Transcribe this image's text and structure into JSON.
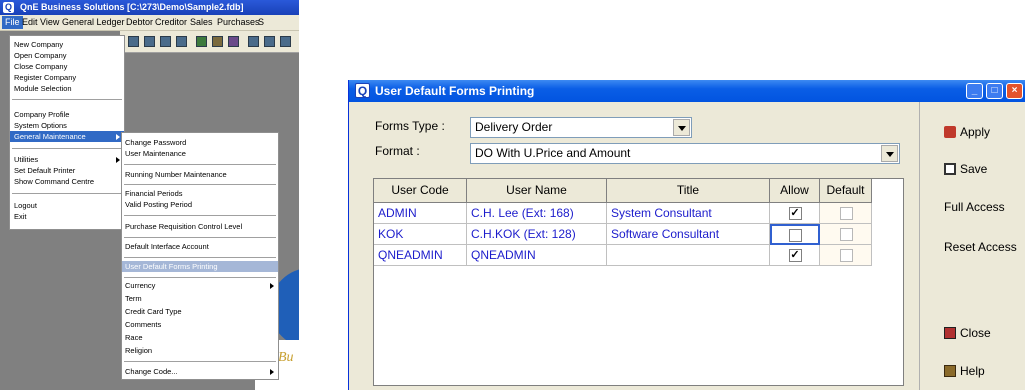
{
  "app": {
    "title": "QnE Business Solutions [C:\\273\\Demo\\Sample2.fdb]",
    "menubar": [
      "File",
      "Edit",
      "View",
      "General Ledger",
      "Debtor",
      "Creditor",
      "Sales",
      "Purchases",
      "S"
    ],
    "file_menu": [
      "New Company",
      "Open Company",
      "Close Company",
      "Register Company",
      "Module Selection",
      "Company Profile",
      "System Options",
      "General Maintenance",
      "Utilities",
      "Set Default Printer",
      "Show Command Centre",
      "Logout",
      "Exit"
    ],
    "submenu": [
      "Change Password",
      "User Maintenance",
      "Running Number Maintenance",
      "Financial Periods",
      "Valid Posting Period",
      "Purchase Requisition Control Level",
      "Default Interface Account",
      "User Default Forms Printing",
      "Currency",
      "Term",
      "Credit Card Type",
      "Comments",
      "Race",
      "Religion",
      "Change Code..."
    ],
    "logo_text": "Bu"
  },
  "window": {
    "title": "User Default Forms Printing",
    "forms_type_label": "Forms Type :",
    "forms_type_value": "Delivery Order",
    "format_label": "Format :",
    "format_value": "DO With U.Price and Amount",
    "columns": [
      "User Code",
      "User Name",
      "Title",
      "Allow",
      "Default"
    ],
    "rows": [
      {
        "code": "ADMIN",
        "name": "C.H. Lee (Ext: 168)",
        "title": "System Consultant",
        "allow": true,
        "default": false
      },
      {
        "code": "KOK",
        "name": "C.H.KOK (Ext: 128)",
        "title": "Software Consultant",
        "allow": false,
        "default": false
      },
      {
        "code": "QNEADMIN",
        "name": "QNEADMIN",
        "title": "",
        "allow": true,
        "default": false
      }
    ],
    "buttons": {
      "apply": "Apply",
      "save": "Save",
      "full_access": "Full Access",
      "reset_access": "Reset Access",
      "close": "Close",
      "help": "Help"
    }
  }
}
